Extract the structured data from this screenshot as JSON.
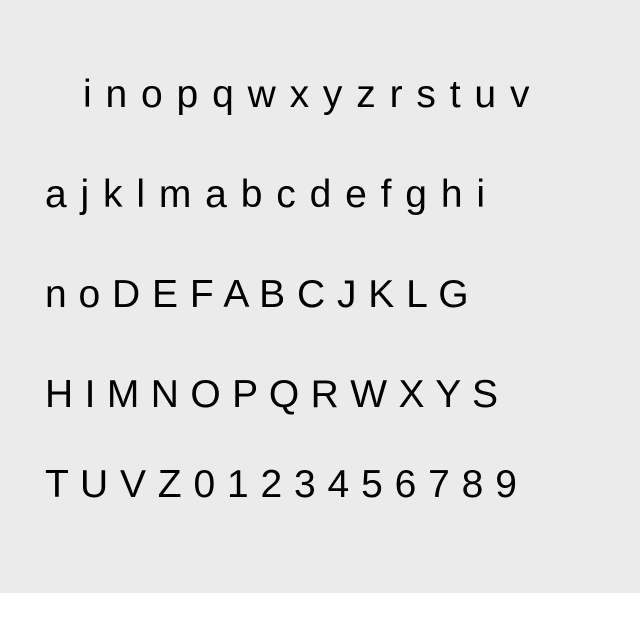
{
  "lines": [
    "i n o p q w x y z r s t u v",
    "a j k l m a b c d e f g h i",
    "n o D E F A B C J K L G",
    "H I M N O P Q R W X Y S",
    "T U V Z 0 1 2 3 4 5 6 7 8 9"
  ],
  "colors": {
    "background": "#ebebeb",
    "text": "#000000"
  }
}
